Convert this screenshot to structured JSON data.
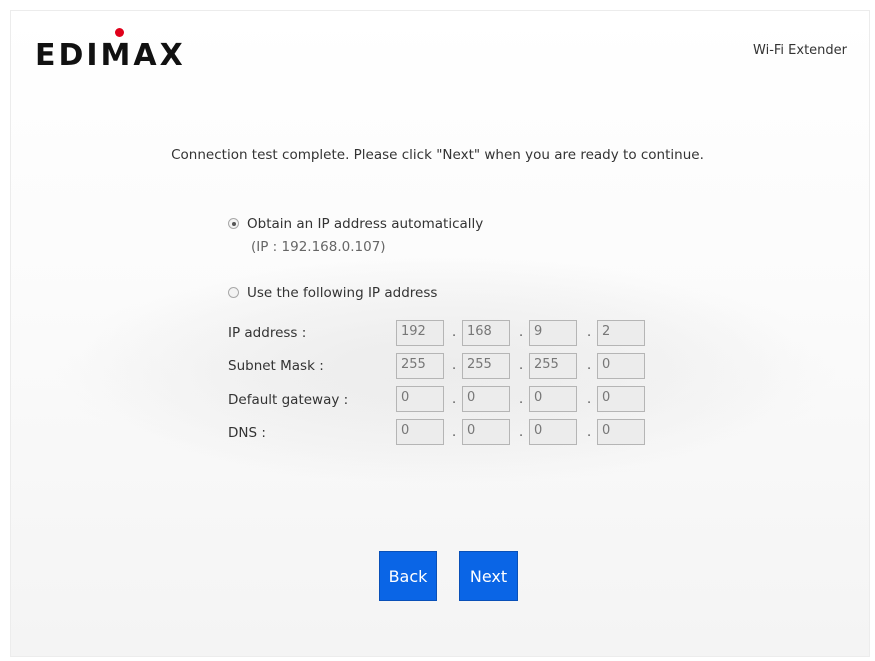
{
  "header": {
    "logo_text": "EDIMAX",
    "product_name": "Wi-Fi Extender"
  },
  "message": "Connection test complete. Please click \"Next\" when you are ready to continue.",
  "options": {
    "auto": {
      "label": "Obtain an IP address automatically",
      "checked": true,
      "hint": "(IP : 192.168.0.107)"
    },
    "manual": {
      "label": "Use the following IP address",
      "checked": false
    }
  },
  "fields": [
    {
      "label": "IP address :",
      "octets": [
        "192",
        "168",
        "9",
        "2"
      ]
    },
    {
      "label": "Subnet Mask :",
      "octets": [
        "255",
        "255",
        "255",
        "0"
      ]
    },
    {
      "label": "Default gateway :",
      "octets": [
        "0",
        "0",
        "0",
        "0"
      ]
    },
    {
      "label": "DNS :",
      "octets": [
        "0",
        "0",
        "0",
        "0"
      ]
    }
  ],
  "buttons": {
    "back": "Back",
    "next": "Next"
  },
  "colors": {
    "button_bg": "#0a65e6",
    "logo_dot": "#e0001a",
    "disabled_field_bg": "#ececec"
  }
}
